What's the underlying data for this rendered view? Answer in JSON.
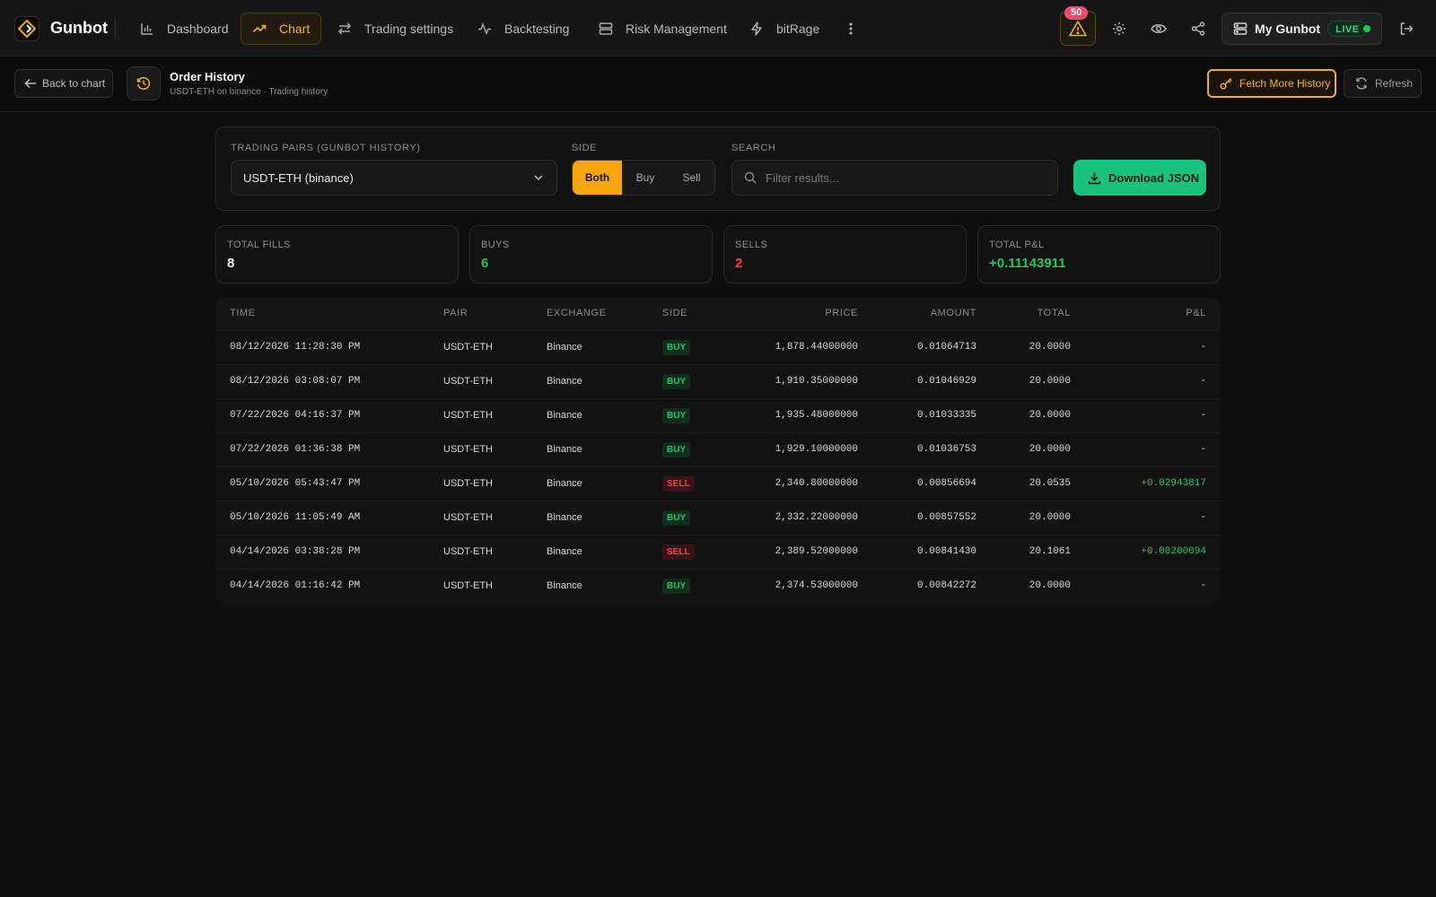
{
  "colors": {
    "accent": "#f4a60c",
    "buy": "#22c55e",
    "sell": "#ef4444",
    "download": "#19c37d",
    "background": "#0f0f0f"
  },
  "brand": {
    "name": "Gunbot",
    "logo_icon": "gunbot-logo-icon"
  },
  "nav": {
    "items": [
      {
        "label": "Dashboard",
        "icon": "bar-chart-icon",
        "active": false
      },
      {
        "label": "Chart",
        "icon": "trending-up-icon",
        "active": true
      },
      {
        "label": "Trading settings",
        "icon": "arrows-exchange-icon",
        "active": false
      },
      {
        "label": "Backtesting",
        "icon": "activity-icon",
        "active": false
      },
      {
        "label": "Risk Management",
        "icon": "server-icon",
        "active": false
      },
      {
        "label": "bitRage",
        "icon": "lightning-icon",
        "active": false
      }
    ],
    "more_icon": "more-vertical-icon",
    "alerts_count": "50",
    "gunbot_label": "My Gunbot",
    "live_label": "LIVE"
  },
  "subheader": {
    "back_label": "Back to chart",
    "title": "Order History",
    "subtitle": "USDT-ETH on binance · Trading history",
    "fetch_label": "Fetch More History",
    "refresh_label": "Refresh"
  },
  "filters": {
    "pairs_label": "TRADING PAIRS (GUNBOT HISTORY)",
    "pair_value": "USDT-ETH (binance)",
    "side_label": "SIDE",
    "side_options": [
      "Both",
      "Buy",
      "Sell"
    ],
    "side_selected": "Both",
    "search_label": "SEARCH",
    "search_placeholder": "Filter results...",
    "download_label": "Download JSON"
  },
  "stats": [
    {
      "label": "TOTAL FILLS",
      "value": "8",
      "tone": "neutral"
    },
    {
      "label": "BUYS",
      "value": "6",
      "tone": "buy"
    },
    {
      "label": "SELLS",
      "value": "2",
      "tone": "sell"
    },
    {
      "label": "TOTAL P&L",
      "value": "+0.11143911",
      "tone": "buy"
    }
  ],
  "table": {
    "columns": [
      "TIME",
      "PAIR",
      "EXCHANGE",
      "SIDE",
      "PRICE",
      "AMOUNT",
      "TOTAL",
      "P&L"
    ],
    "rows": [
      {
        "time": "08/12/2026 11:28:30 PM",
        "pair": "USDT-ETH",
        "exchange": "Binance",
        "side": "BUY",
        "price": "1,878.44000000",
        "amount": "0.01064713",
        "total": "20.0000",
        "pnl": "-"
      },
      {
        "time": "08/12/2026 03:08:07 PM",
        "pair": "USDT-ETH",
        "exchange": "Binance",
        "side": "BUY",
        "price": "1,910.35000000",
        "amount": "0.01046929",
        "total": "20.0000",
        "pnl": "-"
      },
      {
        "time": "07/22/2026 04:16:37 PM",
        "pair": "USDT-ETH",
        "exchange": "Binance",
        "side": "BUY",
        "price": "1,935.48000000",
        "amount": "0.01033335",
        "total": "20.0000",
        "pnl": "-"
      },
      {
        "time": "07/22/2026 01:36:38 PM",
        "pair": "USDT-ETH",
        "exchange": "Binance",
        "side": "BUY",
        "price": "1,929.10000000",
        "amount": "0.01036753",
        "total": "20.0000",
        "pnl": "-"
      },
      {
        "time": "05/10/2026 05:43:47 PM",
        "pair": "USDT-ETH",
        "exchange": "Binance",
        "side": "SELL",
        "price": "2,340.80000000",
        "amount": "0.00856694",
        "total": "20.0535",
        "pnl": "+0.02943817"
      },
      {
        "time": "05/10/2026 11:05:49 AM",
        "pair": "USDT-ETH",
        "exchange": "Binance",
        "side": "BUY",
        "price": "2,332.22000000",
        "amount": "0.00857552",
        "total": "20.0000",
        "pnl": "-"
      },
      {
        "time": "04/14/2026 03:38:28 PM",
        "pair": "USDT-ETH",
        "exchange": "Binance",
        "side": "SELL",
        "price": "2,389.52000000",
        "amount": "0.00841430",
        "total": "20.1061",
        "pnl": "+0.08200094"
      },
      {
        "time": "04/14/2026 01:16:42 PM",
        "pair": "USDT-ETH",
        "exchange": "Binance",
        "side": "BUY",
        "price": "2,374.53000000",
        "amount": "0.00842272",
        "total": "20.0000",
        "pnl": "-"
      }
    ]
  }
}
